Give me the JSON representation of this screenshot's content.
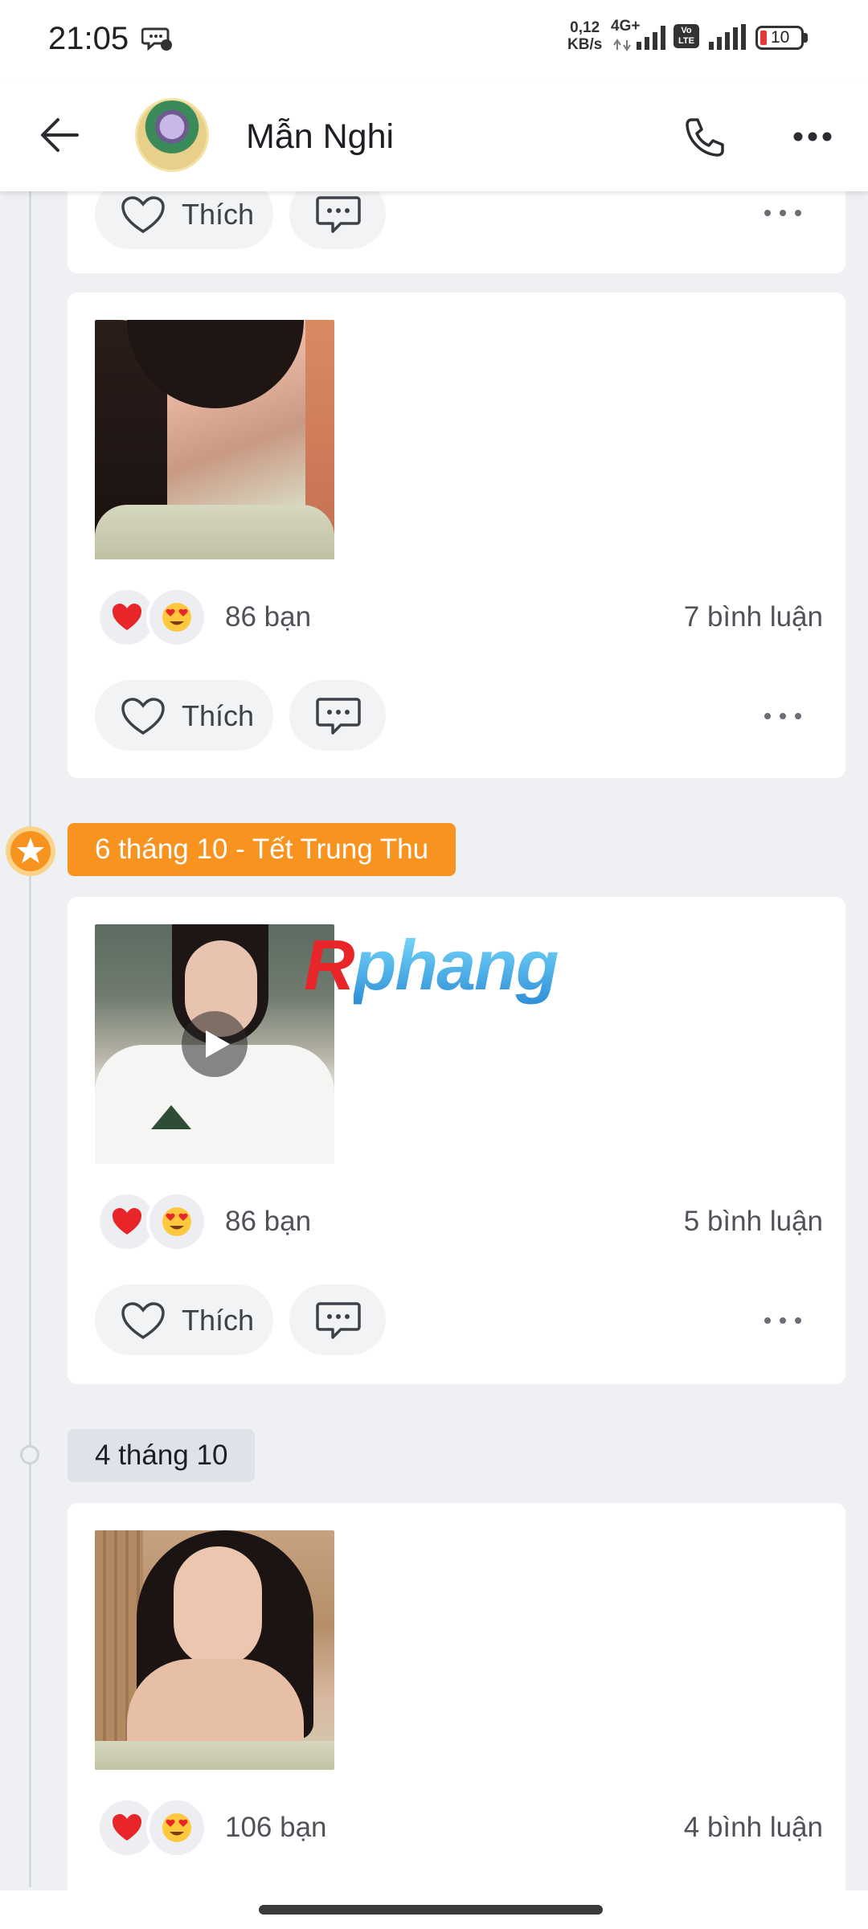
{
  "status_bar": {
    "time": "21:05",
    "net_speed_value": "0,12",
    "net_speed_unit": "KB/s",
    "network_type": "4G+",
    "volte_top": "Vo",
    "volte_bottom": "LTE",
    "battery_level": "10"
  },
  "header": {
    "contact_name": "Mẫn Nghi"
  },
  "posts": [
    {
      "like_label": "Thích"
    },
    {
      "likes": "86 bạn",
      "comments": "7 bình luận",
      "like_label": "Thích"
    },
    {
      "date": "6 tháng 10 - Tết Trung Thu",
      "likes": "86 bạn",
      "comments": "5 bình luận",
      "like_label": "Thích",
      "media": "video"
    },
    {
      "date": "4 tháng 10",
      "likes": "106 bạn",
      "comments": "4 bình luận"
    }
  ],
  "watermark": {
    "first": "R",
    "rest": "phang"
  },
  "colors": {
    "holiday_pill": "#f7931e",
    "background": "#eef0f4",
    "reaction_heart": "#e8262a"
  }
}
